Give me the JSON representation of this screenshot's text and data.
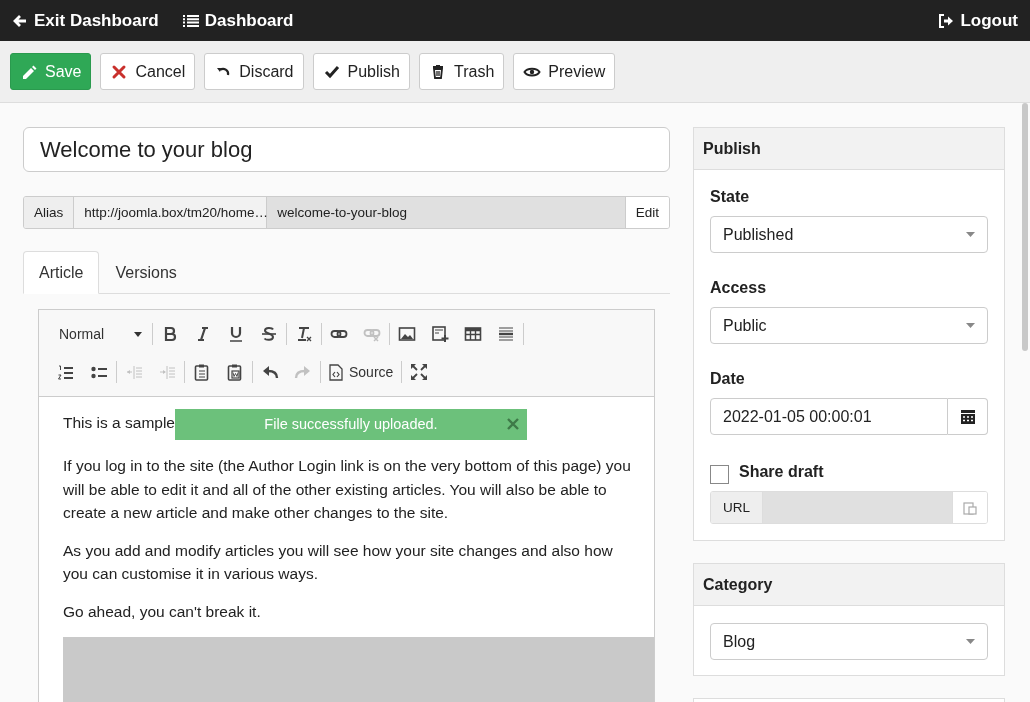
{
  "header": {
    "exit_label": "Exit Dashboard",
    "dashboard_label": "Dashboard",
    "logout_label": "Logout"
  },
  "toolbar": [
    {
      "kind": "save",
      "label": "Save"
    },
    {
      "kind": "cancel",
      "label": "Cancel"
    },
    {
      "kind": "discard",
      "label": "Discard"
    },
    {
      "kind": "publish",
      "label": "Publish"
    },
    {
      "kind": "trash",
      "label": "Trash"
    },
    {
      "kind": "preview",
      "label": "Preview"
    }
  ],
  "title_field": {
    "value": "Welcome to your blog"
  },
  "alias": {
    "label": "Alias",
    "base_url": "http://joomla.box/tm20/home…",
    "value": "welcome-to-your-blog",
    "edit_label": "Edit"
  },
  "tabs": [
    {
      "label": "Article",
      "selected": true
    },
    {
      "label": "Versions",
      "selected": false
    }
  ],
  "editor": {
    "tool_rows": [
      [
        [
          {
            "kind": "format",
            "label": "Normal",
            "disabled": false
          }
        ],
        [
          {
            "kind": "bold",
            "disabled": false
          },
          {
            "kind": "italic",
            "disabled": false
          },
          {
            "kind": "underline",
            "disabled": false
          },
          {
            "kind": "strike",
            "disabled": false
          }
        ],
        [
          {
            "kind": "clear-format",
            "disabled": false
          }
        ],
        [
          {
            "kind": "link",
            "disabled": false
          },
          {
            "kind": "unlink",
            "disabled": true
          }
        ],
        [
          {
            "kind": "image",
            "disabled": false
          },
          {
            "kind": "template",
            "disabled": false
          },
          {
            "kind": "table",
            "disabled": false
          },
          {
            "kind": "rule",
            "disabled": false
          }
        ]
      ],
      [
        [
          {
            "kind": "ordered-list",
            "disabled": false
          },
          {
            "kind": "bullet-list",
            "disabled": false
          }
        ],
        [
          {
            "kind": "outdent",
            "disabled": true
          },
          {
            "kind": "indent",
            "disabled": true
          }
        ],
        [
          {
            "kind": "paste",
            "disabled": false
          },
          {
            "kind": "paste-word",
            "disabled": false
          }
        ],
        [
          {
            "kind": "undo",
            "disabled": false
          },
          {
            "kind": "redo",
            "disabled": true
          }
        ],
        [
          {
            "kind": "source",
            "label": "Source",
            "disabled": false
          }
        ],
        [
          {
            "kind": "maximize",
            "disabled": false
          }
        ]
      ]
    ],
    "paragraphs": [
      "This is a sample",
      "If you log in to the site (the Author Login link is on the very bottom of this page) you will be able to edit it and all of the other existing articles. You will also be able to create a new article and make other changes to the site.",
      "As you add and modify articles you will see how your site changes and also how you can customise it in various ways.",
      "Go ahead, you can't break it."
    ],
    "toast": {
      "message": "File successfully uploaded."
    }
  },
  "publish_panel": {
    "title": "Publish",
    "state_label": "State",
    "state_value": "Published",
    "access_label": "Access",
    "access_value": "Public",
    "date_label": "Date",
    "date_value": "2022-01-05 00:00:01",
    "share_label": "Share draft",
    "share_checked": false,
    "url_label": "URL"
  },
  "category_panel": {
    "title": "Category",
    "value": "Blog"
  }
}
